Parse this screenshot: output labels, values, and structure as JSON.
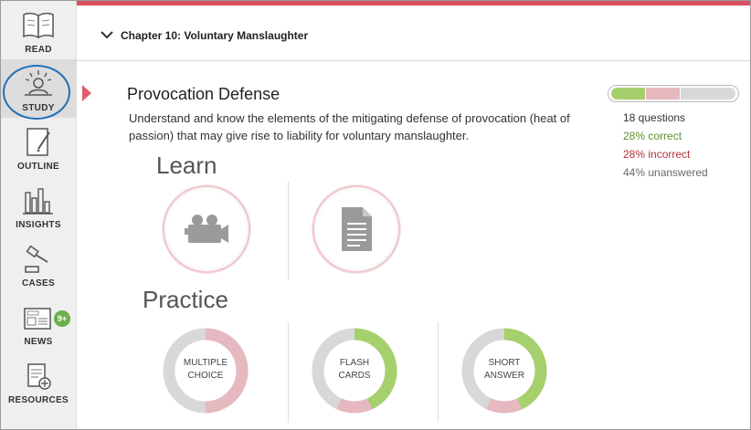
{
  "sidebar": {
    "items": [
      {
        "label": "READ",
        "icon": "book-icon"
      },
      {
        "label": "STUDY",
        "icon": "student-icon"
      },
      {
        "label": "OUTLINE",
        "icon": "notepad-pencil-icon"
      },
      {
        "label": "INSIGHTS",
        "icon": "bar-chart-icon"
      },
      {
        "label": "CASES",
        "icon": "gavel-icon"
      },
      {
        "label": "NEWS",
        "icon": "newspaper-icon",
        "badge": "9+"
      },
      {
        "label": "RESOURCES",
        "icon": "document-plus-icon"
      }
    ],
    "active": "STUDY"
  },
  "header": {
    "chapter_title": "Chapter 10: Voluntary Manslaughter"
  },
  "topic": {
    "title": "Provocation Defense",
    "description": "Understand and know the elements of the mitigating defense of provocation (heat of passion) that may give rise to liability for voluntary manslaughter."
  },
  "progress": {
    "questions": "18 questions",
    "correct": "28% correct",
    "incorrect": "28% incorrect",
    "unanswered": "44% unanswered",
    "correct_frac": 0.28,
    "incorrect_frac": 0.28,
    "unanswered_frac": 0.44
  },
  "learn": {
    "heading": "Learn",
    "tiles": [
      {
        "icon": "video-camera-icon"
      },
      {
        "icon": "document-icon"
      }
    ]
  },
  "practice": {
    "heading": "Practice",
    "tiles": [
      {
        "line1": "MULTIPLE",
        "line2": "CHOICE",
        "correct": 0,
        "incorrect": 0.5
      },
      {
        "line1": "FLASH",
        "line2": "CARDS",
        "correct": 0.43,
        "incorrect": 0.14
      },
      {
        "line1": "SHORT",
        "line2": "ANSWER",
        "correct": 0.43,
        "incorrect": 0.14
      }
    ]
  },
  "colors": {
    "correct": "#a6d06b",
    "incorrect": "#e6b8bf",
    "unanswered": "#d8d8d8",
    "accent": "#d9505f",
    "active_ring": "#1f6fb8"
  }
}
